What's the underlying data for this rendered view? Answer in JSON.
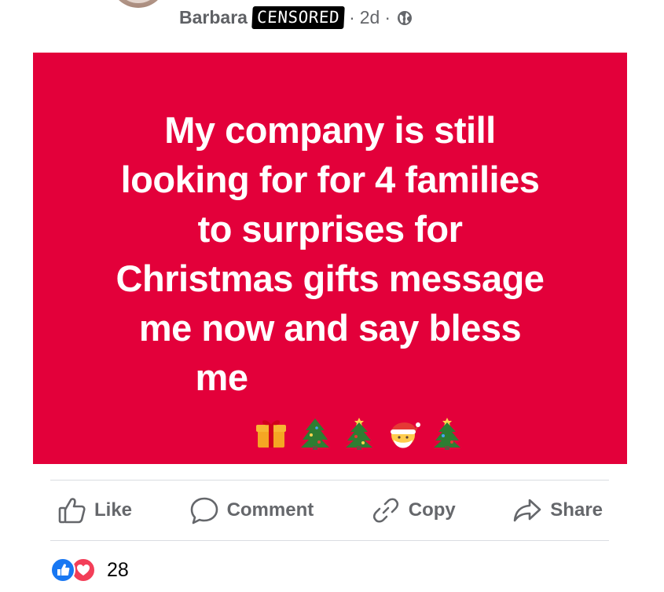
{
  "post": {
    "author": "Barbara",
    "censor_label": "CENSORED",
    "time": "2d",
    "separator": "·",
    "visibility_icon": "globe-icon"
  },
  "card": {
    "background": "#e3003a",
    "text": "My company is still\nlooking for for 4 families\nto surprises for\nChristmas gifts message\nme now and say bless\nme",
    "emojis": [
      "gift-emoji",
      "christmas-tree-emoji",
      "christmas-tree-emoji",
      "santa-emoji",
      "christmas-tree-emoji"
    ]
  },
  "actions": {
    "like": "Like",
    "comment": "Comment",
    "copy": "Copy",
    "share": "Share"
  },
  "reactions": {
    "count": "28",
    "types": [
      "like",
      "love"
    ]
  }
}
